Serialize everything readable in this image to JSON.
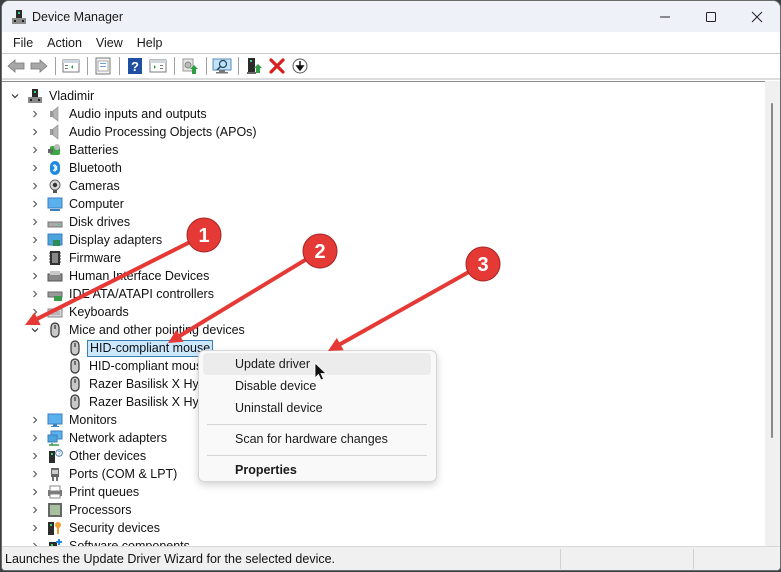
{
  "window": {
    "title": "Device Manager",
    "controls": {
      "minimize": "minimize",
      "maximize": "maximize",
      "close": "close"
    }
  },
  "menubar": {
    "items": [
      {
        "label": "File"
      },
      {
        "label": "Action"
      },
      {
        "label": "View"
      },
      {
        "label": "Help"
      }
    ]
  },
  "toolbar": {
    "buttons": [
      {
        "icon": "back-arrow-icon",
        "tooltip": "Back"
      },
      {
        "icon": "forward-arrow-icon",
        "tooltip": "Forward"
      },
      {
        "icon": "show-hide-console-tree-icon"
      },
      {
        "icon": "properties-icon"
      },
      {
        "icon": "help-icon"
      },
      {
        "icon": "show-action-pane-icon"
      },
      {
        "icon": "update-driver-icon"
      },
      {
        "icon": "scan-hardware-icon"
      },
      {
        "icon": "enable-device-icon"
      },
      {
        "icon": "uninstall-device-icon"
      },
      {
        "icon": "download-icon"
      }
    ]
  },
  "tree": {
    "root": {
      "label": "Vladimir",
      "expanded": true
    },
    "categories": [
      {
        "label": "Audio inputs and outputs",
        "icon": "speaker-icon",
        "expanded": false
      },
      {
        "label": "Audio Processing Objects (APOs)",
        "icon": "speaker-icon",
        "expanded": false
      },
      {
        "label": "Batteries",
        "icon": "battery-icon",
        "expanded": false
      },
      {
        "label": "Bluetooth",
        "icon": "bluetooth-icon",
        "expanded": false
      },
      {
        "label": "Cameras",
        "icon": "camera-icon",
        "expanded": false
      },
      {
        "label": "Computer",
        "icon": "computer-icon",
        "expanded": false
      },
      {
        "label": "Disk drives",
        "icon": "disk-drive-icon",
        "expanded": false
      },
      {
        "label": "Display adapters",
        "icon": "display-adapter-icon",
        "expanded": false
      },
      {
        "label": "Firmware",
        "icon": "firmware-icon",
        "expanded": false
      },
      {
        "label": "Human Interface Devices",
        "icon": "hid-icon",
        "expanded": false
      },
      {
        "label": "IDE ATA/ATAPI controllers",
        "icon": "ide-controller-icon",
        "expanded": false
      },
      {
        "label": "Keyboards",
        "icon": "keyboard-icon",
        "expanded": false
      },
      {
        "label": "Mice and other pointing devices",
        "icon": "mouse-icon",
        "expanded": true,
        "children": [
          {
            "label": "HID-compliant mouse",
            "selected": true
          },
          {
            "label": "HID-compliant mouse"
          },
          {
            "label": "Razer Basilisk X HyperSpeed"
          },
          {
            "label": "Razer Basilisk X HyperSpeed"
          }
        ]
      },
      {
        "label": "Monitors",
        "icon": "monitor-icon",
        "expanded": false
      },
      {
        "label": "Network adapters",
        "icon": "network-adapter-icon",
        "expanded": false
      },
      {
        "label": "Other devices",
        "icon": "other-devices-icon",
        "expanded": false
      },
      {
        "label": "Ports (COM & LPT)",
        "icon": "port-icon",
        "expanded": false
      },
      {
        "label": "Print queues",
        "icon": "printer-icon",
        "expanded": false
      },
      {
        "label": "Processors",
        "icon": "processor-icon",
        "expanded": false
      },
      {
        "label": "Security devices",
        "icon": "security-device-icon",
        "expanded": false
      },
      {
        "label": "Software components",
        "icon": "software-component-icon",
        "expanded": false
      }
    ]
  },
  "context_menu": {
    "items": [
      {
        "label": "Update driver",
        "hover": true
      },
      {
        "label": "Disable device"
      },
      {
        "label": "Uninstall device"
      },
      {
        "separator": true
      },
      {
        "label": "Scan for hardware changes"
      },
      {
        "separator": true
      },
      {
        "label": "Properties",
        "bold": true
      }
    ]
  },
  "statusbar": {
    "text": "Launches the Update Driver Wizard for the selected device."
  },
  "annotations": {
    "color": "#e53935",
    "badges": [
      {
        "number": "1",
        "points_to": "Mice and other pointing devices expand chevron"
      },
      {
        "number": "2",
        "points_to": "HID-compliant mouse"
      },
      {
        "number": "3",
        "points_to": "Update driver"
      }
    ]
  }
}
